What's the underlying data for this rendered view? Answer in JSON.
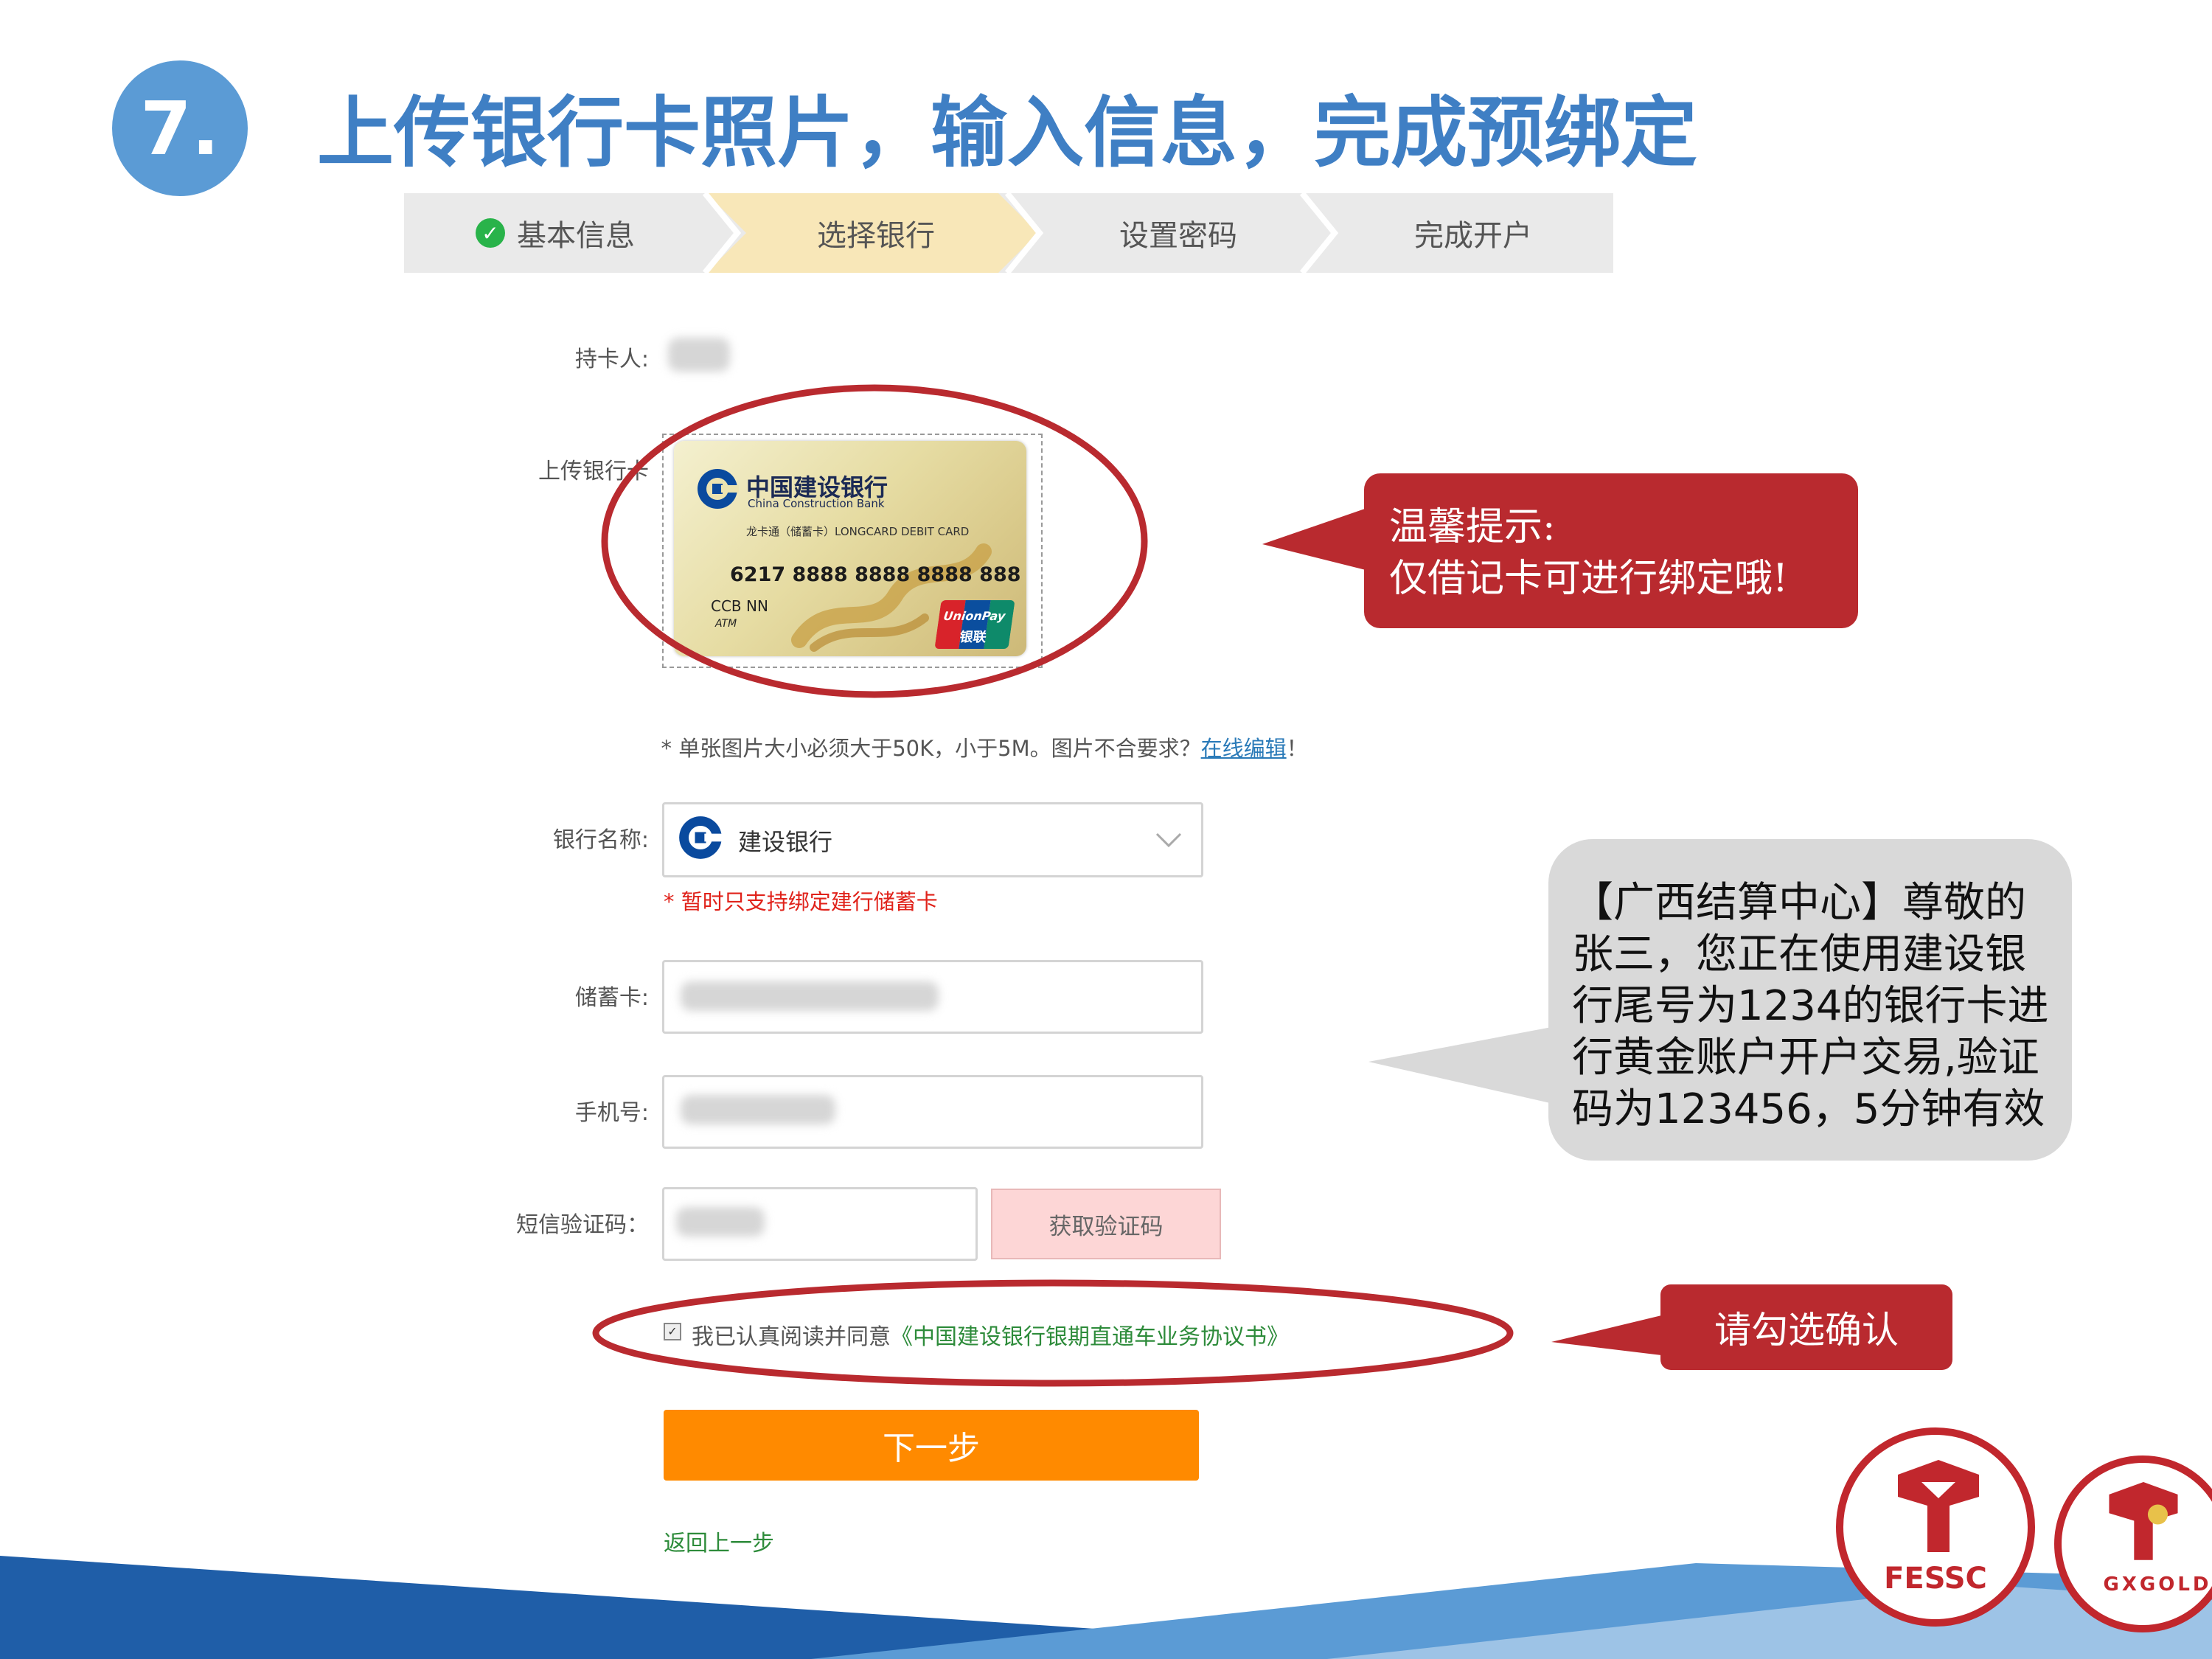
{
  "header": {
    "step_number": "7.",
    "title": "上传银行卡照片，输入信息，完成预绑定"
  },
  "steps": [
    {
      "label": "基本信息",
      "state": "done"
    },
    {
      "label": "选择银行",
      "state": "active"
    },
    {
      "label": "设置密码",
      "state": "pending"
    },
    {
      "label": "完成开户",
      "state": "pending"
    }
  ],
  "form": {
    "cardholder_label": "持卡人:",
    "upload_label": "上传银行卡",
    "card": {
      "bank_cn": "中国建设银行",
      "bank_en": "China Construction Bank",
      "product": "龙卡通（储蓄卡）LONGCARD DEBIT CARD",
      "number": "6217 8888 8888 8888 888",
      "name": "CCB NN",
      "atm": "ATM",
      "unionpay": "UnionPay",
      "unionpay_cn": "银联"
    },
    "upload_note_prefix": "* 单张图片大小必须大于50K，小于5M。图片不合要求？",
    "upload_note_link": "在线编辑",
    "upload_note_suffix": "！",
    "bank_name_label": "银行名称:",
    "bank_selected": "建设银行",
    "bank_note": "* 暂时只支持绑定建行储蓄卡",
    "debit_card_label": "储蓄卡:",
    "phone_label": "手机号:",
    "sms_code_label": "短信验证码：",
    "get_code_button": "获取验证码",
    "agree_text": "我已认真阅读并同意",
    "agree_link": "《中国建设银行银期直通车业务协议书》",
    "agree_checked": true,
    "next_button": "下一步",
    "back_link": "返回上一步"
  },
  "callouts": {
    "tip_line1": "温馨提示:",
    "tip_line2": "仅借记卡可进行绑定哦!",
    "sms_line1": "【广西结算中心】尊敬的",
    "sms_line2": "张三，您正在使用建设银",
    "sms_line3": "行尾号为1234的银行卡进",
    "sms_line4": "行黄金账户开户交易,验证",
    "sms_line5": "码为123456，5分钟有效",
    "confirm": "请勾选确认"
  },
  "logos": {
    "left": "FESSC",
    "right": "GXGOLD"
  },
  "colors": {
    "title_blue": "#3f7fc4",
    "step_circle": "#5b9bd5",
    "callout_red": "#b92a2f",
    "next_orange": "#ff8a00",
    "note_red": "#e0221a",
    "link_green": "#2d8b3a",
    "footer_blue": "#1f5ea8"
  }
}
